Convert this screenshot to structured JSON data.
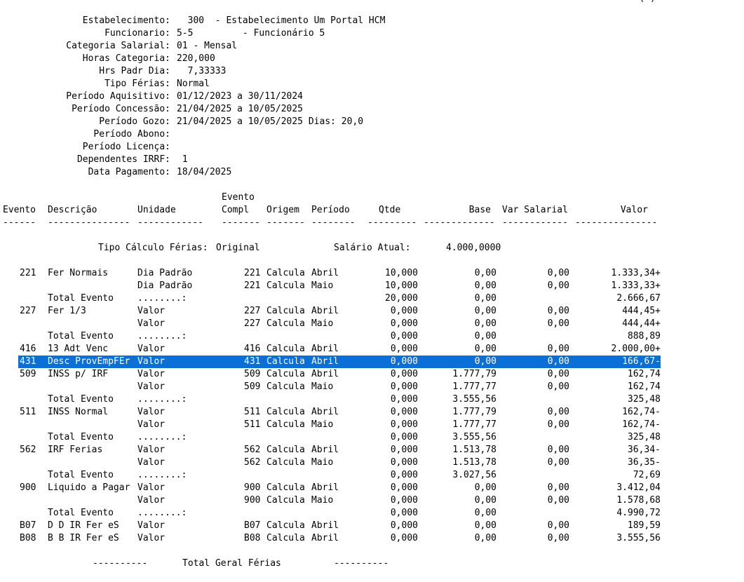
{
  "corner_mark": "(-)",
  "header": [
    {
      "label": "Estabelecimento:",
      "value": "  300  - Estabelecimento Um Portal HCM"
    },
    {
      "label": "Funcionario:",
      "value": "5-5         - Funcionário 5"
    },
    {
      "label": "Categoria Salarial:",
      "value": "01 - Mensal"
    },
    {
      "label": "Horas Categoria:",
      "value": "220,000"
    },
    {
      "label": "Hrs Padr Dia:",
      "value": "  7,33333"
    },
    {
      "label": "Tipo Férias:",
      "value": "Normal"
    },
    {
      "label": "Período Aquisitivo:",
      "value": "01/12/2023 a 30/11/2024"
    },
    {
      "label": "Período Concessão:",
      "value": "21/04/2025 a 10/05/2025"
    },
    {
      "label": "Período Gozo:",
      "value": "21/04/2025 a 10/05/2025 Dias: 20,0"
    },
    {
      "label": "Período Abono:",
      "value": ""
    },
    {
      "label": "Período Licença:",
      "value": ""
    },
    {
      "label": "Dependentes IRRF:",
      "value": " 1"
    },
    {
      "label": "Data Pagamento:",
      "value": "18/04/2025"
    }
  ],
  "columns": {
    "evento": "Evento",
    "descricao": "Descrição",
    "unidade": "Unidade",
    "evento_compl_1": "Evento",
    "evento_compl_2": "Compl",
    "origem": "Origem",
    "periodo": "Período",
    "qtde": "Qtde",
    "base": "Base",
    "var_salarial": "Var Salarial",
    "valor": "Valor"
  },
  "separators": {
    "evento": "------",
    "descricao": "---------------",
    "unidade": "------------",
    "compl": "-------",
    "origem": "-------",
    "periodo": "--------",
    "qtde": "---------",
    "base": "-------------",
    "var": "------------",
    "valor": "---------------"
  },
  "tipo_calculo": {
    "label": "Tipo Cálculo Férias:",
    "value": "Original",
    "salario_label": "Salário Atual:",
    "salario_value": "4.000,0000"
  },
  "rows": [
    {
      "ev": "221",
      "desc": "Fer Normais",
      "un": "Dia Padrão",
      "compl": "221",
      "orig": "Calcula",
      "per": "Abril",
      "qtde": "10,000",
      "base": "0,00",
      "var": "0,00",
      "valor": "1.333,34+"
    },
    {
      "ev": "",
      "desc": "",
      "un": "Dia Padrão",
      "compl": "221",
      "orig": "Calcula",
      "per": "Maio",
      "qtde": "10,000",
      "base": "0,00",
      "var": "0,00",
      "valor": "1.333,33+"
    },
    {
      "ev": "",
      "desc": "Total Evento",
      "un": "........:",
      "compl": "",
      "orig": "",
      "per": "",
      "qtde": "20,000",
      "base": "0,00",
      "var": "",
      "valor": "2.666,67"
    },
    {
      "ev": "227",
      "desc": "Fer 1/3",
      "un": "Valor",
      "compl": "227",
      "orig": "Calcula",
      "per": "Abril",
      "qtde": "0,000",
      "base": "0,00",
      "var": "0,00",
      "valor": "444,45+"
    },
    {
      "ev": "",
      "desc": "",
      "un": "Valor",
      "compl": "227",
      "orig": "Calcula",
      "per": "Maio",
      "qtde": "0,000",
      "base": "0,00",
      "var": "0,00",
      "valor": "444,44+"
    },
    {
      "ev": "",
      "desc": "Total Evento",
      "un": "........:",
      "compl": "",
      "orig": "",
      "per": "",
      "qtde": "0,000",
      "base": "0,00",
      "var": "",
      "valor": "888,89"
    },
    {
      "ev": "416",
      "desc": "13 Adt Venc",
      "un": "Valor",
      "compl": "416",
      "orig": "Calcula",
      "per": "Abril",
      "qtde": "0,000",
      "base": "0,00",
      "var": "0,00",
      "valor": "2.000,00+"
    },
    {
      "ev": "431",
      "desc": "Desc ProvEmpFEr",
      "un": "Valor",
      "compl": "431",
      "orig": "Calcula",
      "per": "Abril",
      "qtde": "0,000",
      "base": "0,00",
      "var": "0,00",
      "valor": "166,67-",
      "selected": true
    },
    {
      "ev": "509",
      "desc": "INSS p/ IRF",
      "un": "Valor",
      "compl": "509",
      "orig": "Calcula",
      "per": "Abril",
      "qtde": "0,000",
      "base": "1.777,79",
      "var": "0,00",
      "valor": "162,74"
    },
    {
      "ev": "",
      "desc": "",
      "un": "Valor",
      "compl": "509",
      "orig": "Calcula",
      "per": "Maio",
      "qtde": "0,000",
      "base": "1.777,77",
      "var": "0,00",
      "valor": "162,74"
    },
    {
      "ev": "",
      "desc": "Total Evento",
      "un": "........:",
      "compl": "",
      "orig": "",
      "per": "",
      "qtde": "0,000",
      "base": "3.555,56",
      "var": "",
      "valor": "325,48"
    },
    {
      "ev": "511",
      "desc": "INSS Normal",
      "un": "Valor",
      "compl": "511",
      "orig": "Calcula",
      "per": "Abril",
      "qtde": "0,000",
      "base": "1.777,79",
      "var": "0,00",
      "valor": "162,74-"
    },
    {
      "ev": "",
      "desc": "",
      "un": "Valor",
      "compl": "511",
      "orig": "Calcula",
      "per": "Maio",
      "qtde": "0,000",
      "base": "1.777,77",
      "var": "0,00",
      "valor": "162,74-"
    },
    {
      "ev": "",
      "desc": "Total Evento",
      "un": "........:",
      "compl": "",
      "orig": "",
      "per": "",
      "qtde": "0,000",
      "base": "3.555,56",
      "var": "",
      "valor": "325,48"
    },
    {
      "ev": "562",
      "desc": "IRF Ferias",
      "un": "Valor",
      "compl": "562",
      "orig": "Calcula",
      "per": "Abril",
      "qtde": "0,000",
      "base": "1.513,78",
      "var": "0,00",
      "valor": "36,34-"
    },
    {
      "ev": "",
      "desc": "",
      "un": "Valor",
      "compl": "562",
      "orig": "Calcula",
      "per": "Maio",
      "qtde": "0,000",
      "base": "1.513,78",
      "var": "0,00",
      "valor": "36,35-"
    },
    {
      "ev": "",
      "desc": "Total Evento",
      "un": "........:",
      "compl": "",
      "orig": "",
      "per": "",
      "qtde": "0,000",
      "base": "3.027,56",
      "var": "",
      "valor": "72,69"
    },
    {
      "ev": "900",
      "desc": "Liquido a Pagar",
      "un": "Valor",
      "compl": "900",
      "orig": "Calcula",
      "per": "Abril",
      "qtde": "0,000",
      "base": "0,00",
      "var": "0,00",
      "valor": "3.412,04"
    },
    {
      "ev": "",
      "desc": "",
      "un": "Valor",
      "compl": "900",
      "orig": "Calcula",
      "per": "Maio",
      "qtde": "0,000",
      "base": "0,00",
      "var": "0,00",
      "valor": "1.578,68"
    },
    {
      "ev": "",
      "desc": "Total Evento",
      "un": "........:",
      "compl": "",
      "orig": "",
      "per": "",
      "qtde": "0,000",
      "base": "0,00",
      "var": "",
      "valor": "4.990,72"
    },
    {
      "ev": "B07",
      "desc": "D D IR Fer eS",
      "un": "Valor",
      "compl": "B07",
      "orig": "Calcula",
      "per": "Abril",
      "qtde": "0,000",
      "base": "0,00",
      "var": "0,00",
      "valor": "189,59"
    },
    {
      "ev": "B08",
      "desc": "B B IR Fer eS",
      "un": "Valor",
      "compl": "B08",
      "orig": "Calcula",
      "per": "Abril",
      "qtde": "0,000",
      "base": "0,00",
      "var": "0,00",
      "valor": "3.555,56"
    }
  ],
  "footer": {
    "dash_left": "----------",
    "label": "Total Geral Férias",
    "dash_right": "----------"
  }
}
